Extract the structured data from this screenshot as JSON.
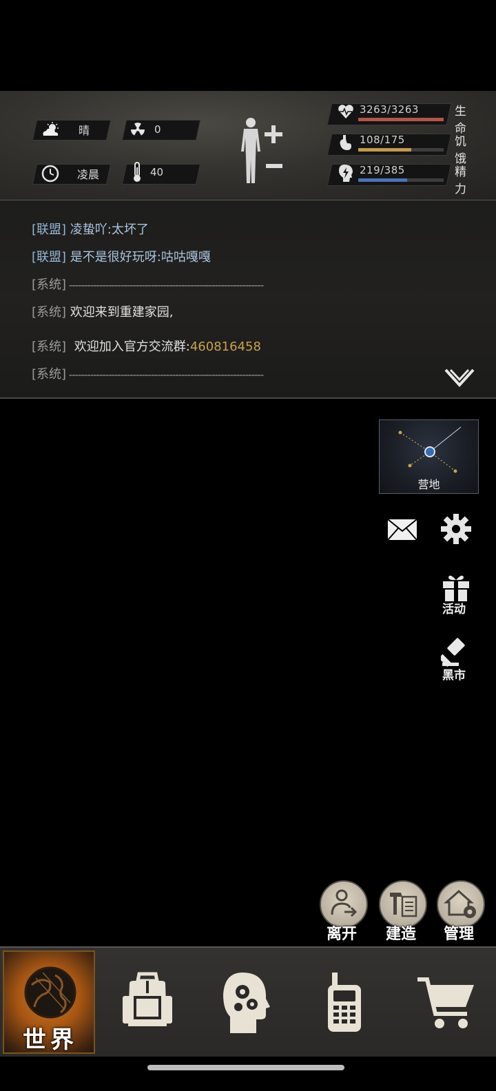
{
  "status": {
    "weather": "晴",
    "radiation": "0",
    "time": "凌晨",
    "temperature": "40",
    "vitals": [
      {
        "label": "生命",
        "value": "3263/3263",
        "fill": 1.0,
        "color": "#b5544a"
      },
      {
        "label": "饥饿",
        "value": "108/175",
        "fill": 0.62,
        "color": "#c29a4a"
      },
      {
        "label": "精力",
        "value": "219/385",
        "fill": 0.57,
        "color": "#4d73b3"
      }
    ]
  },
  "chat": {
    "lines": [
      {
        "tag": "[联盟]",
        "text": "凌蛰吖:太坏了"
      },
      {
        "tag": "[联盟]",
        "text": "是不是很好玩呀:咕咕嘎嘎"
      },
      {
        "tag": "[系统]",
        "text": "----------------------------------------------------------------"
      },
      {
        "tag": "[系统]",
        "text": "欢迎来到重建家园,"
      },
      {
        "tag": "[系统]",
        "text": "欢迎加入官方交流群:",
        "highlight": "460816458"
      },
      {
        "tag": "[系统]",
        "text": "----------------------------------------------------------------"
      }
    ]
  },
  "side": {
    "camp_label": "营地",
    "activity_label": "活动",
    "black_market_label": "黑市"
  },
  "actions": {
    "leave": "离开",
    "build": "建造",
    "manage": "管理"
  },
  "nav": {
    "world": "世界"
  }
}
